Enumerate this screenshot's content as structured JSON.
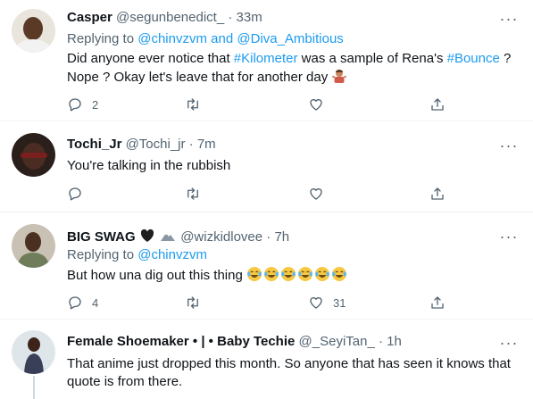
{
  "tweets": [
    {
      "name": "Casper",
      "handle": "@segunbenedict_",
      "separator": "·",
      "time": "33m",
      "replying_prefix": "Replying to",
      "replying_links": [
        "@chinvzvm",
        "@Diva_Ambitious"
      ],
      "replying_and": "and",
      "text_parts": [
        "Did anyone ever notice that ",
        "#Kilometer",
        " was a sample of Rena's ",
        "#Bounce",
        " ?",
        "Nope ? Okay let's leave that for another day"
      ],
      "replies": "2",
      "retweets": "",
      "likes": "",
      "emoji": "person-shrugging-emoji"
    },
    {
      "name": "Tochi_Jr",
      "handle": "@Tochi_jr",
      "separator": "·",
      "time": "7m",
      "text": "You're talking in the rubbish",
      "replies": "",
      "retweets": "",
      "likes": ""
    },
    {
      "name": "BIG SWAG",
      "handle": "@wizkidlovee",
      "separator": "·",
      "time": "7h",
      "replying_prefix": "Replying to",
      "replying_link": "@chinvzvm",
      "text": "But how una dig out this thing",
      "emoji": "face-with-tears-of-joy-emoji",
      "emoji_count": 6,
      "replies": "4",
      "retweets": "",
      "likes": "31"
    },
    {
      "name": "Female Shoemaker • | • Baby Techie",
      "handle": "@_SeyiTan_",
      "separator": "·",
      "time": "1h",
      "text": "That anime just dropped this month. So anyone that has seen it knows that quote is from there."
    }
  ],
  "more_label": "···",
  "colors": {
    "link": "#1d9bf0",
    "secondary": "#536471",
    "primary_text": "#0f1419",
    "divider": "#eff3f4"
  },
  "icons": [
    "reply-icon",
    "retweet-icon",
    "like-icon",
    "share-icon",
    "more-icon",
    "black-heart-icon",
    "mountain-icon"
  ]
}
